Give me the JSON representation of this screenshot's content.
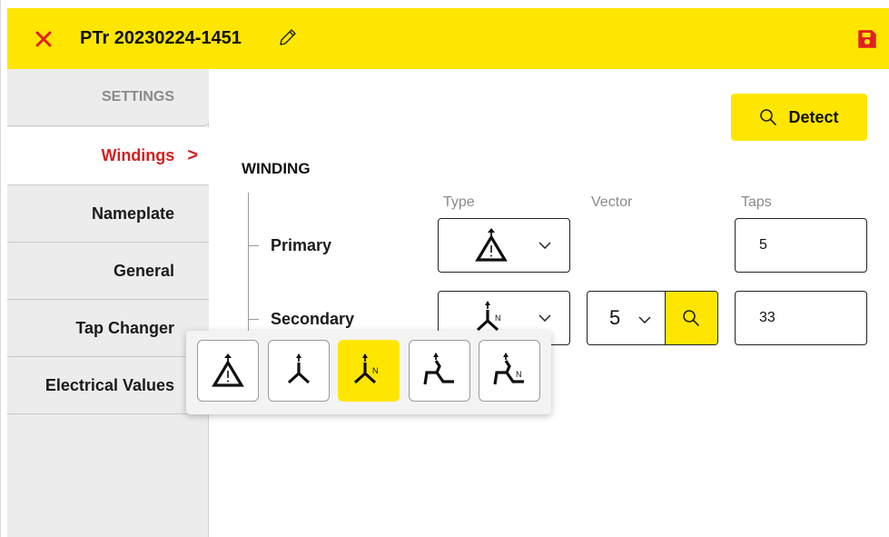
{
  "header": {
    "title": "PTr 20230224-1451",
    "close_icon": "close-icon",
    "edit_icon": "pencil-icon",
    "save_icon": "save-icon",
    "accent_color": "#ffe600",
    "close_color": "#e02020"
  },
  "sidebar": {
    "items": [
      {
        "label": "SETTINGS"
      },
      {
        "label": "Windings",
        "active": true
      },
      {
        "label": "Nameplate"
      },
      {
        "label": "General"
      },
      {
        "label": "Tap Changer"
      },
      {
        "label": "Electrical Values"
      }
    ],
    "chevron": ">",
    "active_color": "#d42020"
  },
  "main": {
    "detect_label": "Detect",
    "section_title": "WINDING",
    "columns": {
      "type": "Type",
      "vector": "Vector",
      "taps": "Taps"
    },
    "rows": [
      {
        "label": "Primary",
        "type_icon": "delta-winding-icon",
        "taps": "5"
      },
      {
        "label": "Secondary",
        "type_icon": "wye-neutral-winding-icon",
        "vector": "5",
        "taps": "33"
      }
    ]
  },
  "popup": {
    "options": [
      {
        "icon": "delta-winding-icon",
        "selected": false
      },
      {
        "icon": "wye-winding-icon",
        "selected": false
      },
      {
        "icon": "wye-neutral-winding-icon",
        "label": "N",
        "selected": true
      },
      {
        "icon": "zigzag-winding-icon",
        "selected": false
      },
      {
        "icon": "zigzag-neutral-winding-icon",
        "label": "N",
        "selected": false
      }
    ]
  }
}
